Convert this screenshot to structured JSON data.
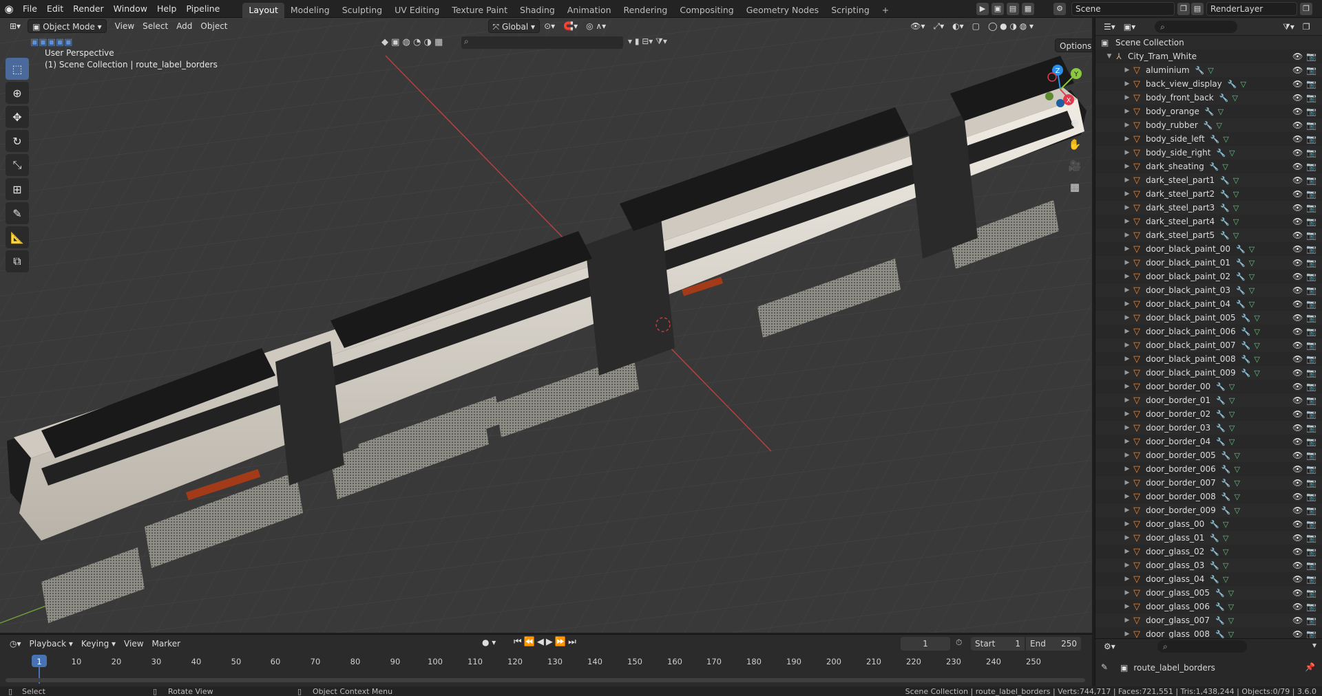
{
  "topbar": {
    "menus": [
      "File",
      "Edit",
      "Render",
      "Window",
      "Help",
      "Pipeline"
    ],
    "workspaces": [
      "Layout",
      "Modeling",
      "Sculpting",
      "UV Editing",
      "Texture Paint",
      "Shading",
      "Animation",
      "Rendering",
      "Compositing",
      "Geometry Nodes",
      "Scripting"
    ],
    "add_tab": "+",
    "scene": "Scene",
    "render_layer": "RenderLayer"
  },
  "viewport": {
    "mode": "Object Mode",
    "menus": [
      "View",
      "Select",
      "Add",
      "Object"
    ],
    "orientation": "Global",
    "options": "Options",
    "view_name": "User Perspective",
    "context": "(1) Scene Collection | route_label_borders",
    "gizmo": {
      "z": "Z",
      "y": "Y",
      "x": "X"
    }
  },
  "outliner": {
    "root": "Scene Collection",
    "collection": "City_Tram_White",
    "objects": [
      "aluminium",
      "back_view_display",
      "body_front_back",
      "body_orange",
      "body_rubber",
      "body_side_left",
      "body_side_right",
      "dark_sheating",
      "dark_steel_part1",
      "dark_steel_part2",
      "dark_steel_part3",
      "dark_steel_part4",
      "dark_steel_part5",
      "door_black_paint_00",
      "door_black_paint_01",
      "door_black_paint_02",
      "door_black_paint_03",
      "door_black_paint_04",
      "door_black_paint_005",
      "door_black_paint_006",
      "door_black_paint_007",
      "door_black_paint_008",
      "door_black_paint_009",
      "door_border_00",
      "door_border_01",
      "door_border_02",
      "door_border_03",
      "door_border_04",
      "door_border_005",
      "door_border_006",
      "door_border_007",
      "door_border_008",
      "door_border_009",
      "door_glass_00",
      "door_glass_01",
      "door_glass_02",
      "door_glass_03",
      "door_glass_04",
      "door_glass_005",
      "door_glass_006",
      "door_glass_007",
      "door_glass_008"
    ]
  },
  "properties": {
    "active_object": "route_label_borders"
  },
  "timeline": {
    "menus": [
      "Playback",
      "Keying",
      "View",
      "Marker"
    ],
    "current_frame": "1",
    "start_label": "Start",
    "start": "1",
    "end_label": "End",
    "end": "250",
    "ticks": [
      "1",
      "10",
      "20",
      "30",
      "40",
      "50",
      "60",
      "70",
      "80",
      "90",
      "100",
      "110",
      "120",
      "130",
      "140",
      "150",
      "160",
      "170",
      "180",
      "190",
      "200",
      "210",
      "220",
      "230",
      "240",
      "250"
    ]
  },
  "status": {
    "select": "Select",
    "rotate": "Rotate View",
    "context_menu": "Object Context Menu",
    "stats": "Scene Collection | route_label_borders | Verts:744,717 | Faces:721,551 | Tris:1,438,244 | Objects:0/79 | 3.6.0"
  },
  "colors": {
    "accent": "#4772b3",
    "object_icon": "#e7873a",
    "mesh_icon": "#5ec87e",
    "axis_x": "#e23a4c",
    "axis_y": "#8bc840",
    "axis_z": "#2b8ee8"
  }
}
